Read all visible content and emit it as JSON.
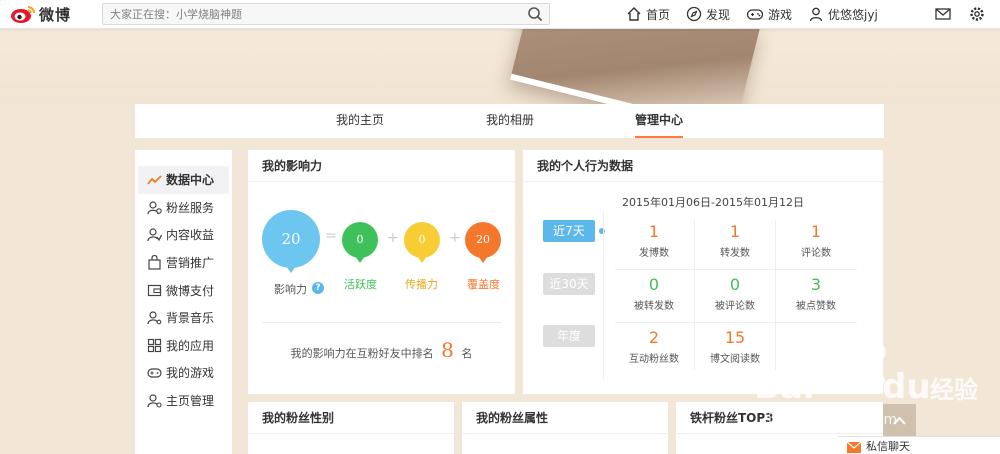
{
  "topbar": {
    "brand": "微博",
    "search_placeholder": "大家正在搜：小学烧脑神题",
    "nav": [
      {
        "label": "首页",
        "icon": "home-icon"
      },
      {
        "label": "发现",
        "icon": "compass-icon"
      },
      {
        "label": "游戏",
        "icon": "gamepad-icon"
      },
      {
        "label": "优悠悠jyj",
        "icon": "user-icon"
      }
    ],
    "mail_icon": "mail-icon",
    "settings_icon": "gear-icon"
  },
  "tabs": [
    {
      "label": "我的主页"
    },
    {
      "label": "我的相册"
    },
    {
      "label": "管理中心",
      "active": true
    }
  ],
  "sidebar": {
    "items": [
      {
        "label": "数据中心",
        "icon": "trend-icon",
        "active": true
      },
      {
        "label": "粉丝服务",
        "icon": "fans-icon"
      },
      {
        "label": "内容收益",
        "icon": "income-icon"
      },
      {
        "label": "营销推广",
        "icon": "bag-icon"
      },
      {
        "label": "微博支付",
        "icon": "wallet-icon"
      },
      {
        "label": "背景音乐",
        "icon": "music-icon"
      },
      {
        "label": "我的应用",
        "icon": "apps-icon"
      },
      {
        "label": "我的游戏",
        "icon": "controller-icon"
      },
      {
        "label": "主页管理",
        "icon": "user-settings-icon"
      }
    ]
  },
  "influence": {
    "title": "我的影响力",
    "total": "20",
    "total_label": "影响力",
    "activity": "0",
    "activity_label": "活跃度",
    "spread": "0",
    "spread_label": "传播力",
    "coverage": "20",
    "coverage_label": "覆盖度",
    "rank_prefix": "我的影响力在互粉好友中排名",
    "rank": "8",
    "rank_suffix": "名",
    "colors": {
      "total": "#6dc6f0",
      "activity": "#3ec15a",
      "spread": "#f7cd35",
      "coverage": "#f4772c"
    }
  },
  "behavior": {
    "title": "我的个人行为数据",
    "date_range": "2015年01月06日-2015年01月12日",
    "periods": [
      {
        "label": "近7天",
        "active": true
      },
      {
        "label": "近30天"
      },
      {
        "label": "年度"
      }
    ],
    "stats": [
      {
        "value": "1",
        "label": "发博数",
        "color": "#f4772c"
      },
      {
        "value": "1",
        "label": "转发数",
        "color": "#f4772c"
      },
      {
        "value": "1",
        "label": "评论数",
        "color": "#f4772c"
      },
      {
        "value": "0",
        "label": "被转发数",
        "color": "#3ec15a"
      },
      {
        "value": "0",
        "label": "被评论数",
        "color": "#3ec15a"
      },
      {
        "value": "3",
        "label": "被点赞数",
        "color": "#3ec15a"
      },
      {
        "value": "2",
        "label": "互动粉丝数",
        "color": "#f4772c"
      },
      {
        "value": "15",
        "label": "博文阅读数",
        "color": "#f4772c"
      }
    ]
  },
  "bottom_panels": [
    {
      "title": "我的粉丝性别"
    },
    {
      "title": "我的粉丝属性"
    },
    {
      "title": "铁杆粉丝TOP3"
    }
  ],
  "message_bar": {
    "label": "私信聊天"
  }
}
